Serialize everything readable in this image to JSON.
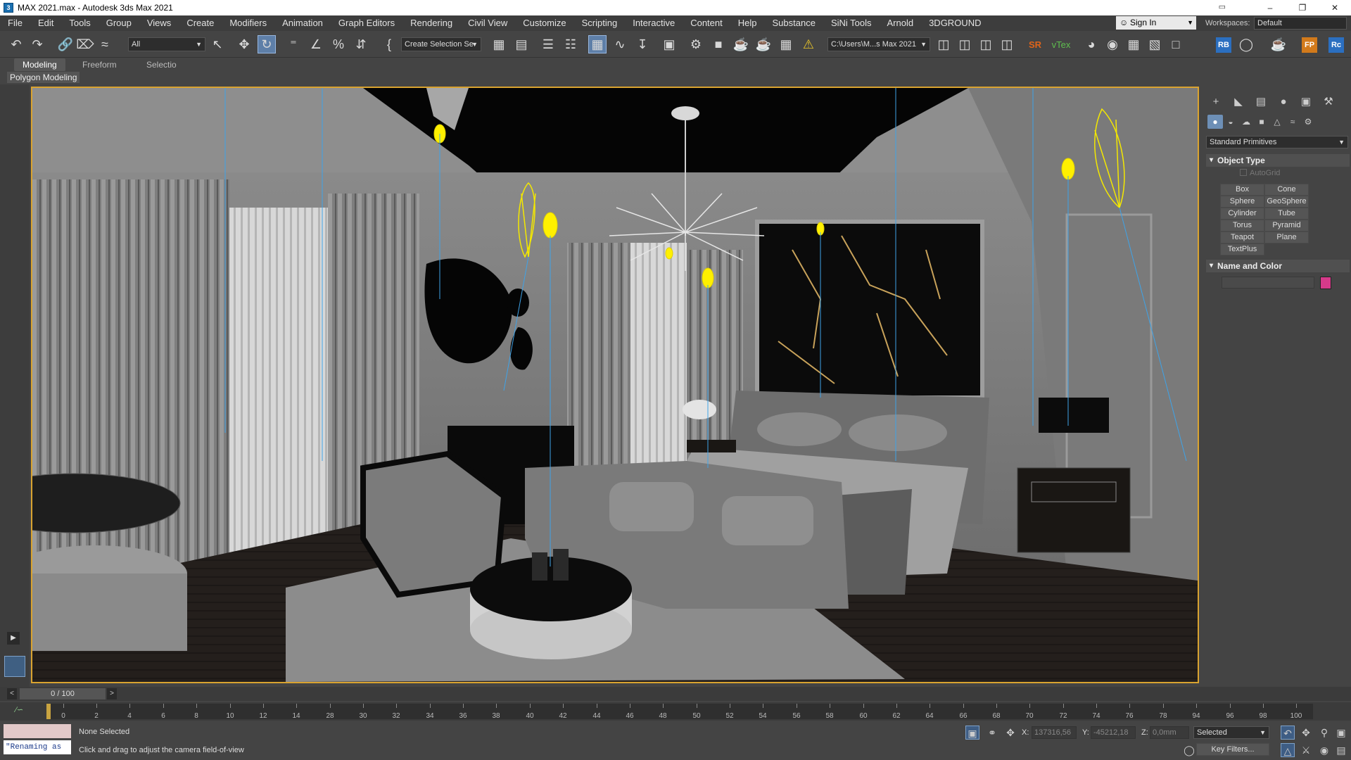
{
  "window": {
    "title": "MAX 2021.max - Autodesk 3ds Max 2021",
    "minimize": "–",
    "restore": "❐",
    "close": "✕"
  },
  "menu": [
    "File",
    "Edit",
    "Tools",
    "Group",
    "Views",
    "Create",
    "Modifiers",
    "Animation",
    "Graph Editors",
    "Rendering",
    "Civil View",
    "Customize",
    "Scripting",
    "Interactive",
    "Content",
    "Help",
    "Substance",
    "SiNi Tools",
    "Arnold",
    "3DGROUND"
  ],
  "account": {
    "signin_label": "Sign In",
    "workspaces_label": "Workspaces:",
    "workspace_value": "Default"
  },
  "toolbar": {
    "selection_filter": "All",
    "named_selection": "Create Selection Se",
    "project_path": "C:\\Users\\M...s Max 2021",
    "sr_label": "SR",
    "vtex_label": "vTex",
    "rb_label": "RB",
    "fp_label": "FP",
    "rc_label": "Rc"
  },
  "ribbon": {
    "tabs": [
      "Modeling",
      "Freeform",
      "Selectio"
    ],
    "active_tab": "Modeling",
    "sub_label": "Polygon Modeling"
  },
  "command_panel": {
    "category": "Standard Primitives",
    "object_type_title": "Object Type",
    "autogrid_label": "AutoGrid",
    "primitives": [
      "Box",
      "Cone",
      "Sphere",
      "GeoSphere",
      "Cylinder",
      "Tube",
      "Torus",
      "Pyramid",
      "Teapot",
      "Plane",
      "TextPlus"
    ],
    "name_color_title": "Name and Color",
    "object_color": "#d63a8a"
  },
  "timeline": {
    "frame_display": "0 / 100",
    "prev": "<",
    "next": ">",
    "ticks": [
      "0",
      "2",
      "4",
      "6",
      "8",
      "10",
      "12",
      "14",
      "28",
      "30",
      "32",
      "34",
      "36",
      "38",
      "40",
      "42",
      "44",
      "46",
      "48",
      "50",
      "52",
      "54",
      "56",
      "58",
      "60",
      "62",
      "64",
      "66",
      "68",
      "70",
      "72",
      "74",
      "76",
      "78",
      "94",
      "96",
      "98",
      "100"
    ]
  },
  "status": {
    "selection": "None Selected",
    "prompt": "Click and drag to adjust the camera field-of-view",
    "maxscript_text": "\"Renaming as",
    "x_label": "X:",
    "x_value": "137316,56",
    "y_label": "Y:",
    "y_value": "-45212,18",
    "z_label": "Z:",
    "z_value": "0,0mm",
    "selected_dropdown": "Selected",
    "key_filters": "Key Filters..."
  }
}
